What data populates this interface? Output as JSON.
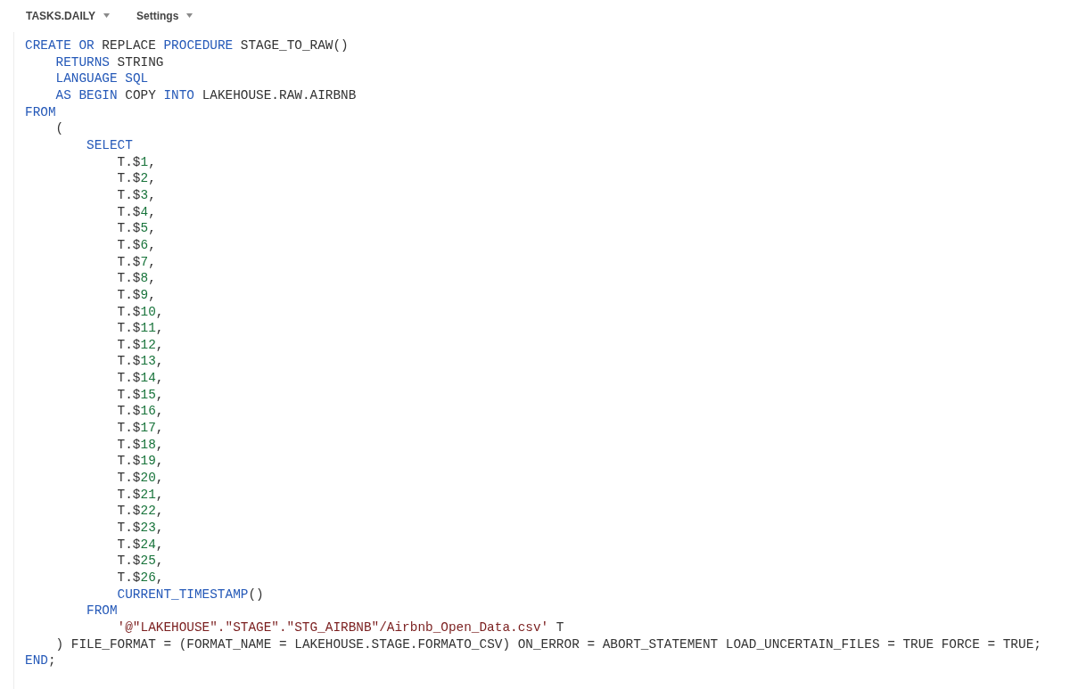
{
  "toolbar": [
    {
      "label": "TASKS.DAILY"
    },
    {
      "label": "Settings"
    }
  ],
  "code_lines": [
    {
      "tokens": [
        {
          "kind": "keyword",
          "text": "CREATE OR"
        },
        {
          "kind": "plain",
          "text": " REPLACE "
        },
        {
          "kind": "keyword",
          "text": "PROCEDURE"
        },
        {
          "kind": "plain",
          "text": " STAGE_TO_RAW()"
        }
      ],
      "children": [
        {
          "tokens": [
            {
              "kind": "keyword",
              "text": "RETURNS"
            },
            {
              "kind": "plain",
              "text": " STRING"
            }
          ]
        },
        {
          "tokens": [
            {
              "kind": "keyword",
              "text": "LANGUAGE SQL"
            }
          ]
        },
        {
          "tokens": [
            {
              "kind": "keyword",
              "text": "AS BEGIN"
            },
            {
              "kind": "plain",
              "text": " COPY "
            },
            {
              "kind": "keyword",
              "text": "INTO"
            },
            {
              "kind": "plain",
              "text": " LAKEHOUSE.RAW.AIRBNB"
            }
          ]
        }
      ]
    },
    {
      "tokens": [
        {
          "kind": "keyword",
          "text": "FROM"
        }
      ],
      "children": [
        {
          "tokens": [
            {
              "kind": "plain",
              "text": "("
            }
          ],
          "children": [
            {
              "tokens": [
                {
                  "kind": "keyword",
                  "text": "SELECT"
                }
              ],
              "children": [
                {
                  "tokens": [
                    {
                      "kind": "plain",
                      "text": "T.$"
                    },
                    {
                      "kind": "number",
                      "text": "1"
                    },
                    {
                      "kind": "plain",
                      "text": ","
                    }
                  ]
                },
                {
                  "tokens": [
                    {
                      "kind": "plain",
                      "text": "T.$"
                    },
                    {
                      "kind": "number",
                      "text": "2"
                    },
                    {
                      "kind": "plain",
                      "text": ","
                    }
                  ]
                },
                {
                  "tokens": [
                    {
                      "kind": "plain",
                      "text": "T.$"
                    },
                    {
                      "kind": "number",
                      "text": "3"
                    },
                    {
                      "kind": "plain",
                      "text": ","
                    }
                  ]
                },
                {
                  "tokens": [
                    {
                      "kind": "plain",
                      "text": "T.$"
                    },
                    {
                      "kind": "number",
                      "text": "4"
                    },
                    {
                      "kind": "plain",
                      "text": ","
                    }
                  ]
                },
                {
                  "tokens": [
                    {
                      "kind": "plain",
                      "text": "T.$"
                    },
                    {
                      "kind": "number",
                      "text": "5"
                    },
                    {
                      "kind": "plain",
                      "text": ","
                    }
                  ]
                },
                {
                  "tokens": [
                    {
                      "kind": "plain",
                      "text": "T.$"
                    },
                    {
                      "kind": "number",
                      "text": "6"
                    },
                    {
                      "kind": "plain",
                      "text": ","
                    }
                  ]
                },
                {
                  "tokens": [
                    {
                      "kind": "plain",
                      "text": "T.$"
                    },
                    {
                      "kind": "number",
                      "text": "7"
                    },
                    {
                      "kind": "plain",
                      "text": ","
                    }
                  ]
                },
                {
                  "tokens": [
                    {
                      "kind": "plain",
                      "text": "T.$"
                    },
                    {
                      "kind": "number",
                      "text": "8"
                    },
                    {
                      "kind": "plain",
                      "text": ","
                    }
                  ]
                },
                {
                  "tokens": [
                    {
                      "kind": "plain",
                      "text": "T.$"
                    },
                    {
                      "kind": "number",
                      "text": "9"
                    },
                    {
                      "kind": "plain",
                      "text": ","
                    }
                  ]
                },
                {
                  "tokens": [
                    {
                      "kind": "plain",
                      "text": "T.$"
                    },
                    {
                      "kind": "number",
                      "text": "10"
                    },
                    {
                      "kind": "plain",
                      "text": ","
                    }
                  ]
                },
                {
                  "tokens": [
                    {
                      "kind": "plain",
                      "text": "T.$"
                    },
                    {
                      "kind": "number",
                      "text": "11"
                    },
                    {
                      "kind": "plain",
                      "text": ","
                    }
                  ]
                },
                {
                  "tokens": [
                    {
                      "kind": "plain",
                      "text": "T.$"
                    },
                    {
                      "kind": "number",
                      "text": "12"
                    },
                    {
                      "kind": "plain",
                      "text": ","
                    }
                  ]
                },
                {
                  "tokens": [
                    {
                      "kind": "plain",
                      "text": "T.$"
                    },
                    {
                      "kind": "number",
                      "text": "13"
                    },
                    {
                      "kind": "plain",
                      "text": ","
                    }
                  ]
                },
                {
                  "tokens": [
                    {
                      "kind": "plain",
                      "text": "T.$"
                    },
                    {
                      "kind": "number",
                      "text": "14"
                    },
                    {
                      "kind": "plain",
                      "text": ","
                    }
                  ]
                },
                {
                  "tokens": [
                    {
                      "kind": "plain",
                      "text": "T.$"
                    },
                    {
                      "kind": "number",
                      "text": "15"
                    },
                    {
                      "kind": "plain",
                      "text": ","
                    }
                  ]
                },
                {
                  "tokens": [
                    {
                      "kind": "plain",
                      "text": "T.$"
                    },
                    {
                      "kind": "number",
                      "text": "16"
                    },
                    {
                      "kind": "plain",
                      "text": ","
                    }
                  ]
                },
                {
                  "tokens": [
                    {
                      "kind": "plain",
                      "text": "T.$"
                    },
                    {
                      "kind": "number",
                      "text": "17"
                    },
                    {
                      "kind": "plain",
                      "text": ","
                    }
                  ]
                },
                {
                  "tokens": [
                    {
                      "kind": "plain",
                      "text": "T.$"
                    },
                    {
                      "kind": "number",
                      "text": "18"
                    },
                    {
                      "kind": "plain",
                      "text": ","
                    }
                  ]
                },
                {
                  "tokens": [
                    {
                      "kind": "plain",
                      "text": "T.$"
                    },
                    {
                      "kind": "number",
                      "text": "19"
                    },
                    {
                      "kind": "plain",
                      "text": ","
                    }
                  ]
                },
                {
                  "tokens": [
                    {
                      "kind": "plain",
                      "text": "T.$"
                    },
                    {
                      "kind": "number",
                      "text": "20"
                    },
                    {
                      "kind": "plain",
                      "text": ","
                    }
                  ]
                },
                {
                  "tokens": [
                    {
                      "kind": "plain",
                      "text": "T.$"
                    },
                    {
                      "kind": "number",
                      "text": "21"
                    },
                    {
                      "kind": "plain",
                      "text": ","
                    }
                  ]
                },
                {
                  "tokens": [
                    {
                      "kind": "plain",
                      "text": "T.$"
                    },
                    {
                      "kind": "number",
                      "text": "22"
                    },
                    {
                      "kind": "plain",
                      "text": ","
                    }
                  ]
                },
                {
                  "tokens": [
                    {
                      "kind": "plain",
                      "text": "T.$"
                    },
                    {
                      "kind": "number",
                      "text": "23"
                    },
                    {
                      "kind": "plain",
                      "text": ","
                    }
                  ]
                },
                {
                  "tokens": [
                    {
                      "kind": "plain",
                      "text": "T.$"
                    },
                    {
                      "kind": "number",
                      "text": "24"
                    },
                    {
                      "kind": "plain",
                      "text": ","
                    }
                  ]
                },
                {
                  "tokens": [
                    {
                      "kind": "plain",
                      "text": "T.$"
                    },
                    {
                      "kind": "number",
                      "text": "25"
                    },
                    {
                      "kind": "plain",
                      "text": ","
                    }
                  ]
                },
                {
                  "tokens": [
                    {
                      "kind": "plain",
                      "text": "T.$"
                    },
                    {
                      "kind": "number",
                      "text": "26"
                    },
                    {
                      "kind": "plain",
                      "text": ","
                    }
                  ]
                },
                {
                  "tokens": [
                    {
                      "kind": "keyword",
                      "text": "CURRENT_TIMESTAMP"
                    },
                    {
                      "kind": "plain",
                      "text": "()"
                    }
                  ]
                }
              ]
            },
            {
              "tokens": [
                {
                  "kind": "keyword",
                  "text": "FROM"
                }
              ],
              "children": [
                {
                  "tokens": [
                    {
                      "kind": "string",
                      "text": "'@\"LAKEHOUSE\".\"STAGE\".\"STG_AIRBNB\"/Airbnb_Open_Data.csv'"
                    },
                    {
                      "kind": "plain",
                      "text": " T"
                    }
                  ]
                }
              ]
            }
          ]
        },
        {
          "tokens": [
            {
              "kind": "plain",
              "text": ") FILE_FORMAT = (FORMAT_NAME = LAKEHOUSE.STAGE.FORMATO_CSV) ON_ERROR = ABORT_STATEMENT LOAD_UNCERTAIN_FILES = TRUE FORCE = TRUE;"
            }
          ]
        }
      ]
    },
    {
      "tokens": [
        {
          "kind": "keyword",
          "text": "END"
        },
        {
          "kind": "plain",
          "text": ";"
        }
      ]
    }
  ]
}
